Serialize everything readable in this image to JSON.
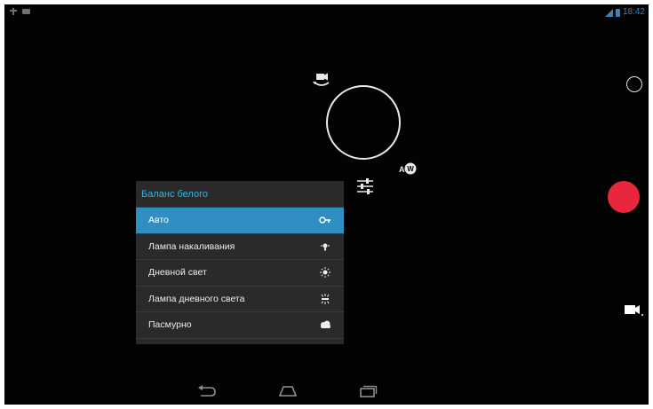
{
  "status_bar": {
    "left_icons": [
      "usb-icon",
      "notification-icon"
    ],
    "right_icons": [
      "signal-icon",
      "battery-icon"
    ],
    "clock": "18:42"
  },
  "camera": {
    "switch_camera_icon": "switch-camera-icon",
    "focus_ring": "focus-ring",
    "white_balance_icon": "white-balance-auto-icon",
    "settings_icon": "settings-sliders-icon",
    "thumbnail_ring": "thumbnail-ring",
    "record_button": "record-button",
    "mode_icon": "video-camera-icon",
    "colors": {
      "record": "#e8263d",
      "accent": "#33b5e5",
      "selected": "#2f8fc2"
    }
  },
  "white_balance_menu": {
    "title": "Баланс белого",
    "items": [
      {
        "label": "Авто",
        "icon": "auto-wb-icon",
        "selected": true
      },
      {
        "label": "Лампа накаливания",
        "icon": "incandescent-icon",
        "selected": false
      },
      {
        "label": "Дневной свет",
        "icon": "sun-icon",
        "selected": false
      },
      {
        "label": "Лампа дневного света",
        "icon": "fluorescent-icon",
        "selected": false
      },
      {
        "label": "Пасмурно",
        "icon": "cloud-icon",
        "selected": false
      }
    ]
  },
  "nav_bar": {
    "buttons": [
      "back-icon",
      "home-icon",
      "recents-icon"
    ]
  }
}
